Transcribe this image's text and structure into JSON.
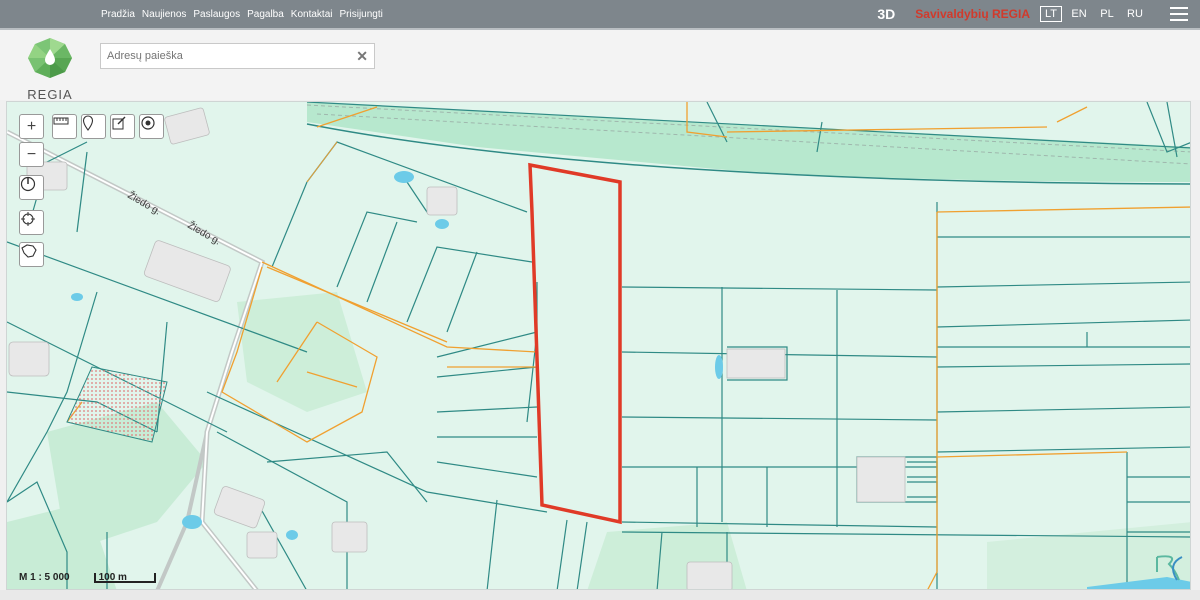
{
  "nav": {
    "items": [
      "Pradžia",
      "Naujienos",
      "Paslaugos",
      "Pagalba",
      "Kontaktai",
      "Prisijungti"
    ]
  },
  "header_right": {
    "mode_3d": "3D",
    "brand": "Savivaldybių REGIA",
    "languages": [
      "LT",
      "EN",
      "PL",
      "RU"
    ],
    "active_language": "LT"
  },
  "logo": {
    "text": "REGIA"
  },
  "search": {
    "placeholder": "Adresų paieška",
    "value": ""
  },
  "map": {
    "street_labels": [
      "Žiedo g.",
      "Žiedo g."
    ],
    "scale_ratio": "M 1 : 5 000",
    "scale_distance": "100 m",
    "colors": {
      "background": "#e1f5ec",
      "parcel_line": "#2f8a85",
      "orange_line": "#f0a030",
      "highlight": "#e03a27",
      "rail_band": "#b7e8ce"
    }
  },
  "toolbar": {
    "icons": [
      "zoom-in-icon",
      "zoom-out-icon",
      "compass-icon",
      "locate-icon",
      "lithuania-outline-icon",
      "measure-icon",
      "pin-icon",
      "edit-icon",
      "target-icon"
    ]
  }
}
